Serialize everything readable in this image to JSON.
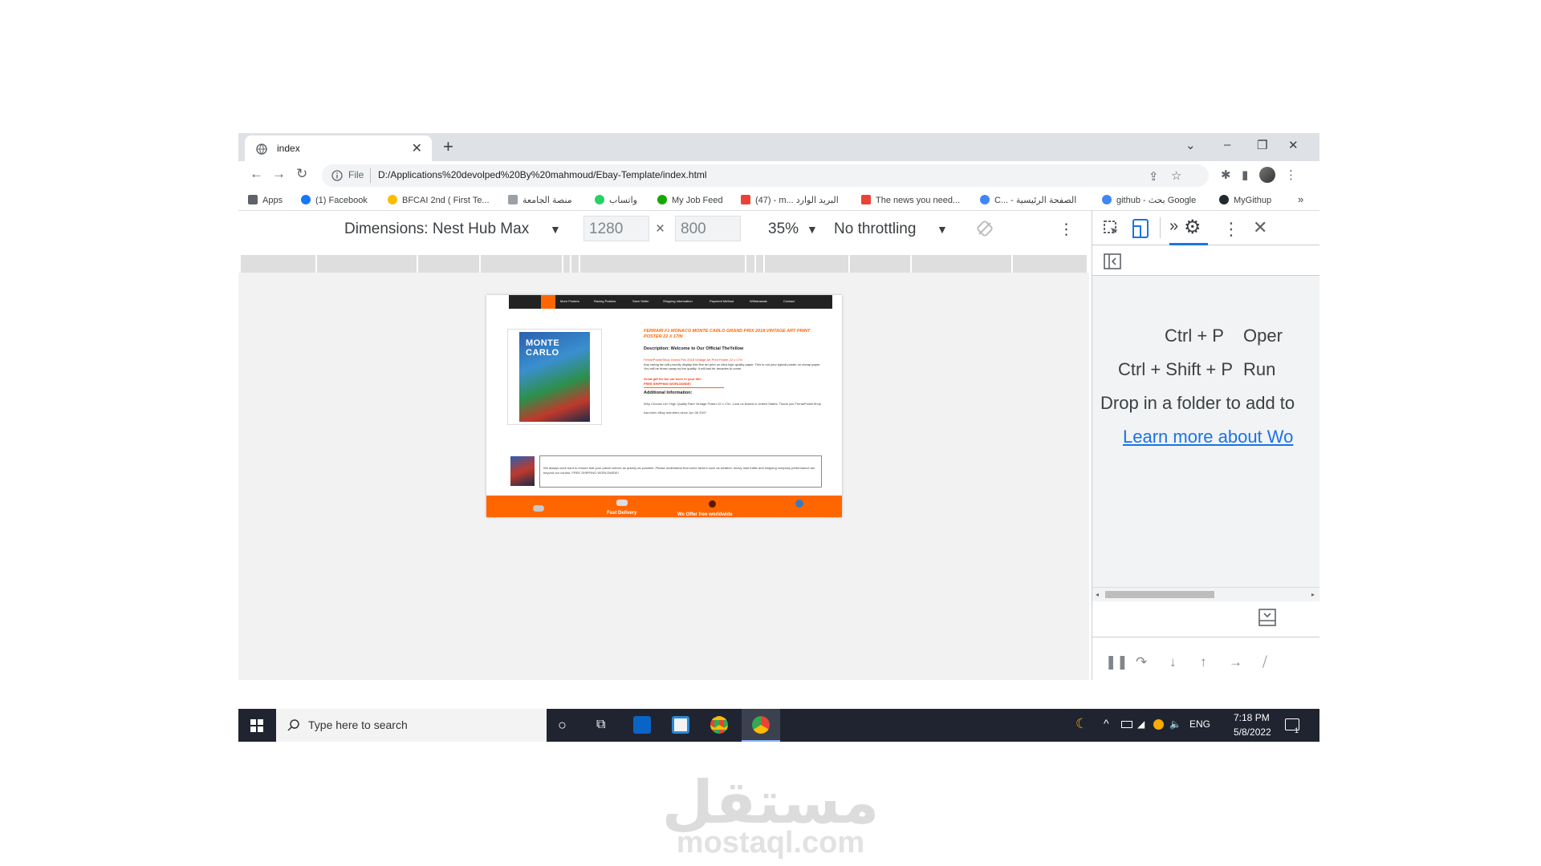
{
  "browser": {
    "tab_title": "index",
    "tab_close": "✕",
    "new_tab": "+",
    "window": {
      "dropdown": "⌄",
      "minimize": "–",
      "restore": "❐",
      "close": "✕"
    },
    "nav": {
      "back": "←",
      "forward": "→",
      "reload": "↻"
    },
    "url_scheme": "File",
    "url": "D:/Applications%20devolped%20By%20mahmoud/Ebay-Template/index.html",
    "toolbar_icons": {
      "share": "⇪",
      "star": "☆",
      "extensions": "✱",
      "sidepanel": "▮",
      "menu": "⋮"
    }
  },
  "bookmarks": [
    {
      "label": "Apps",
      "color": "#5f6368"
    },
    {
      "label": "(1) Facebook",
      "color": "#1877f2"
    },
    {
      "label": "BFCAI 2nd ( First Te...",
      "color": "#fbbc04"
    },
    {
      "label": "منصة الجامعة",
      "color": "#9aa0a6"
    },
    {
      "label": "واتساب",
      "color": "#25d366"
    },
    {
      "label": "My Job Feed",
      "color": "#14a800"
    },
    {
      "label": "(47) - m... البريد الوارد",
      "color": "#ea4335"
    },
    {
      "label": "The news you need...",
      "color": "#ea4335"
    },
    {
      "label": "C... - الصفحة الرئيسية",
      "color": "#4285f4"
    },
    {
      "label": "github - بحث Google",
      "color": "#4285f4"
    },
    {
      "label": "MyGithup",
      "color": "#24292e"
    }
  ],
  "bookmarks_more": "»",
  "device_toolbar": {
    "dimensions": "Dimensions: Nest Hub Max",
    "width": "1280",
    "times": "×",
    "height": "800",
    "zoom": "35%",
    "throttling": "No throttling",
    "caret": "▼",
    "more": "⋮"
  },
  "page": {
    "nav_items": [
      "More Posters",
      "Racing Posters",
      "Save Seller",
      "Shipping Information",
      "Payment Method",
      "Withdrawals",
      "Contact"
    ],
    "poster_text": "MONTE CARLO",
    "product_title": "FERRARI F1 MONACO MONTE CARLO GRAND PRIX 2018 VINTAGE ART PRINT POSTER 22 X 17IN",
    "description_heading": "Description: Welcome to Our Official TheYellow",
    "description_red": "FerrariPosterShop Grand Prix 2018 Vintage Art Print Poster 22 x 17in",
    "description_body": "Any racing fan will proudly display this fine art print on ultra high quality paper. This is not your typical poster on cheap paper. You will be blown away by the quality. It will last for decades to come.",
    "gift_line": "Great gift for the car lover in your life!",
    "shipping_line": "FREE SHIPPING WORLDWIDE!",
    "additional_heading": "Additional Information:",
    "additional_body": "Why Choose Us? High Quality Rare Vintage Poster 22 x 17in. Look us Based in United States. Thank you FerrariPosterShop has been eBay members since Jun 06 2007",
    "box_text": "We always work hard to ensure that your parcel arrives as quickly as possible. Please understand that some factors such as weather, heavy mail traffic and shipping company performance are beyond our control. FREE SHIPPING WORLDWIDE!",
    "footer_items": [
      "Fast Delivery",
      "We Offer free worldwide"
    ]
  },
  "devtools": {
    "shortcut1_keys": "Ctrl + P",
    "shortcut1_action": "Oper",
    "shortcut2_keys": "Ctrl + Shift + P",
    "shortcut2_action": "Run",
    "drop_text": "Drop in a folder to add to",
    "learn_more": "Learn more about Wo",
    "link_color": "#1a73e8"
  },
  "taskbar": {
    "search_placeholder": "Type here to search",
    "lang": "ENG",
    "time": "7:18 PM",
    "date": "5/8/2022",
    "notif": "1"
  },
  "watermark": {
    "arabic": "مستقل",
    "latin": "mostaql.com"
  }
}
